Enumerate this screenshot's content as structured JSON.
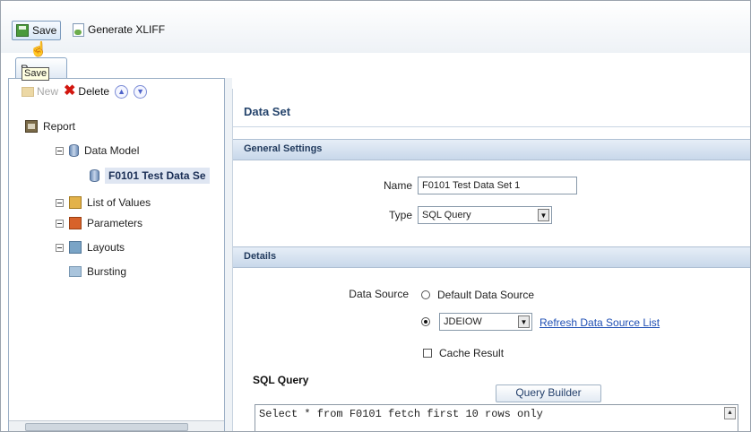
{
  "toolbar": {
    "save_label": "Save",
    "generate_xliff_label": "Generate XLIFF",
    "tooltip": "Save",
    "tab_label": "R"
  },
  "tree_toolbar": {
    "new_label": "New",
    "delete_label": "Delete"
  },
  "tree": {
    "report": "Report",
    "data_model": "Data Model",
    "data_set": "F0101 Test Data Se",
    "list_of_values": "List of Values",
    "parameters": "Parameters",
    "layouts": "Layouts",
    "bursting": "Bursting"
  },
  "panel": {
    "title": "Data Set",
    "general_settings": "General Settings",
    "name_label": "Name",
    "name_value": "F0101 Test Data Set 1",
    "type_label": "Type",
    "type_value": "SQL Query",
    "details": "Details",
    "data_source_label": "Data Source",
    "default_data_source": "Default Data Source",
    "data_source_value": "JDEIOW",
    "refresh_link": "Refresh Data Source List",
    "cache_result": "Cache Result",
    "sql_query_label": "SQL Query",
    "query_builder": "Query Builder",
    "sql_text": "Select * from F0101 fetch first 10 rows only"
  },
  "icons": [
    "save-icon",
    "xliff-icon",
    "new-icon",
    "delete-icon",
    "move-up-icon",
    "move-down-icon",
    "report-icon",
    "data-model-icon",
    "list-of-values-icon",
    "parameters-icon",
    "layouts-icon",
    "bursting-icon"
  ]
}
